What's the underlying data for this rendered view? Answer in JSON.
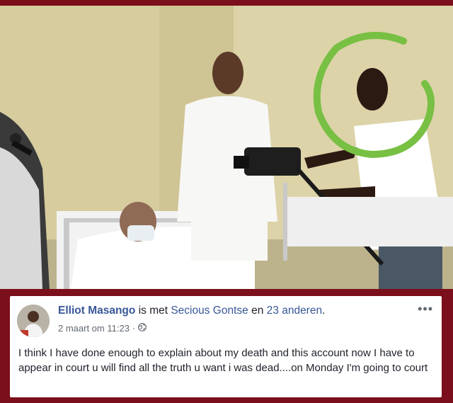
{
  "post": {
    "author": "Elliot Masango",
    "with_text": "is met",
    "tagged_person": "Secious Gontse",
    "and_text": "en",
    "others": "23 anderen",
    "period": ".",
    "timestamp": "2 maart om 11:23",
    "separator": "·",
    "privacy_icon": "globe-icon",
    "more_label": "•••",
    "body": "I think I have done enough to explain about my death and this account now I have to appear in court u will find all the truth u want i was dead....on Monday I'm going to court"
  },
  "colors": {
    "frame": "#7b0f1b",
    "link": "#385898",
    "annotation_circle": "#78c043"
  }
}
